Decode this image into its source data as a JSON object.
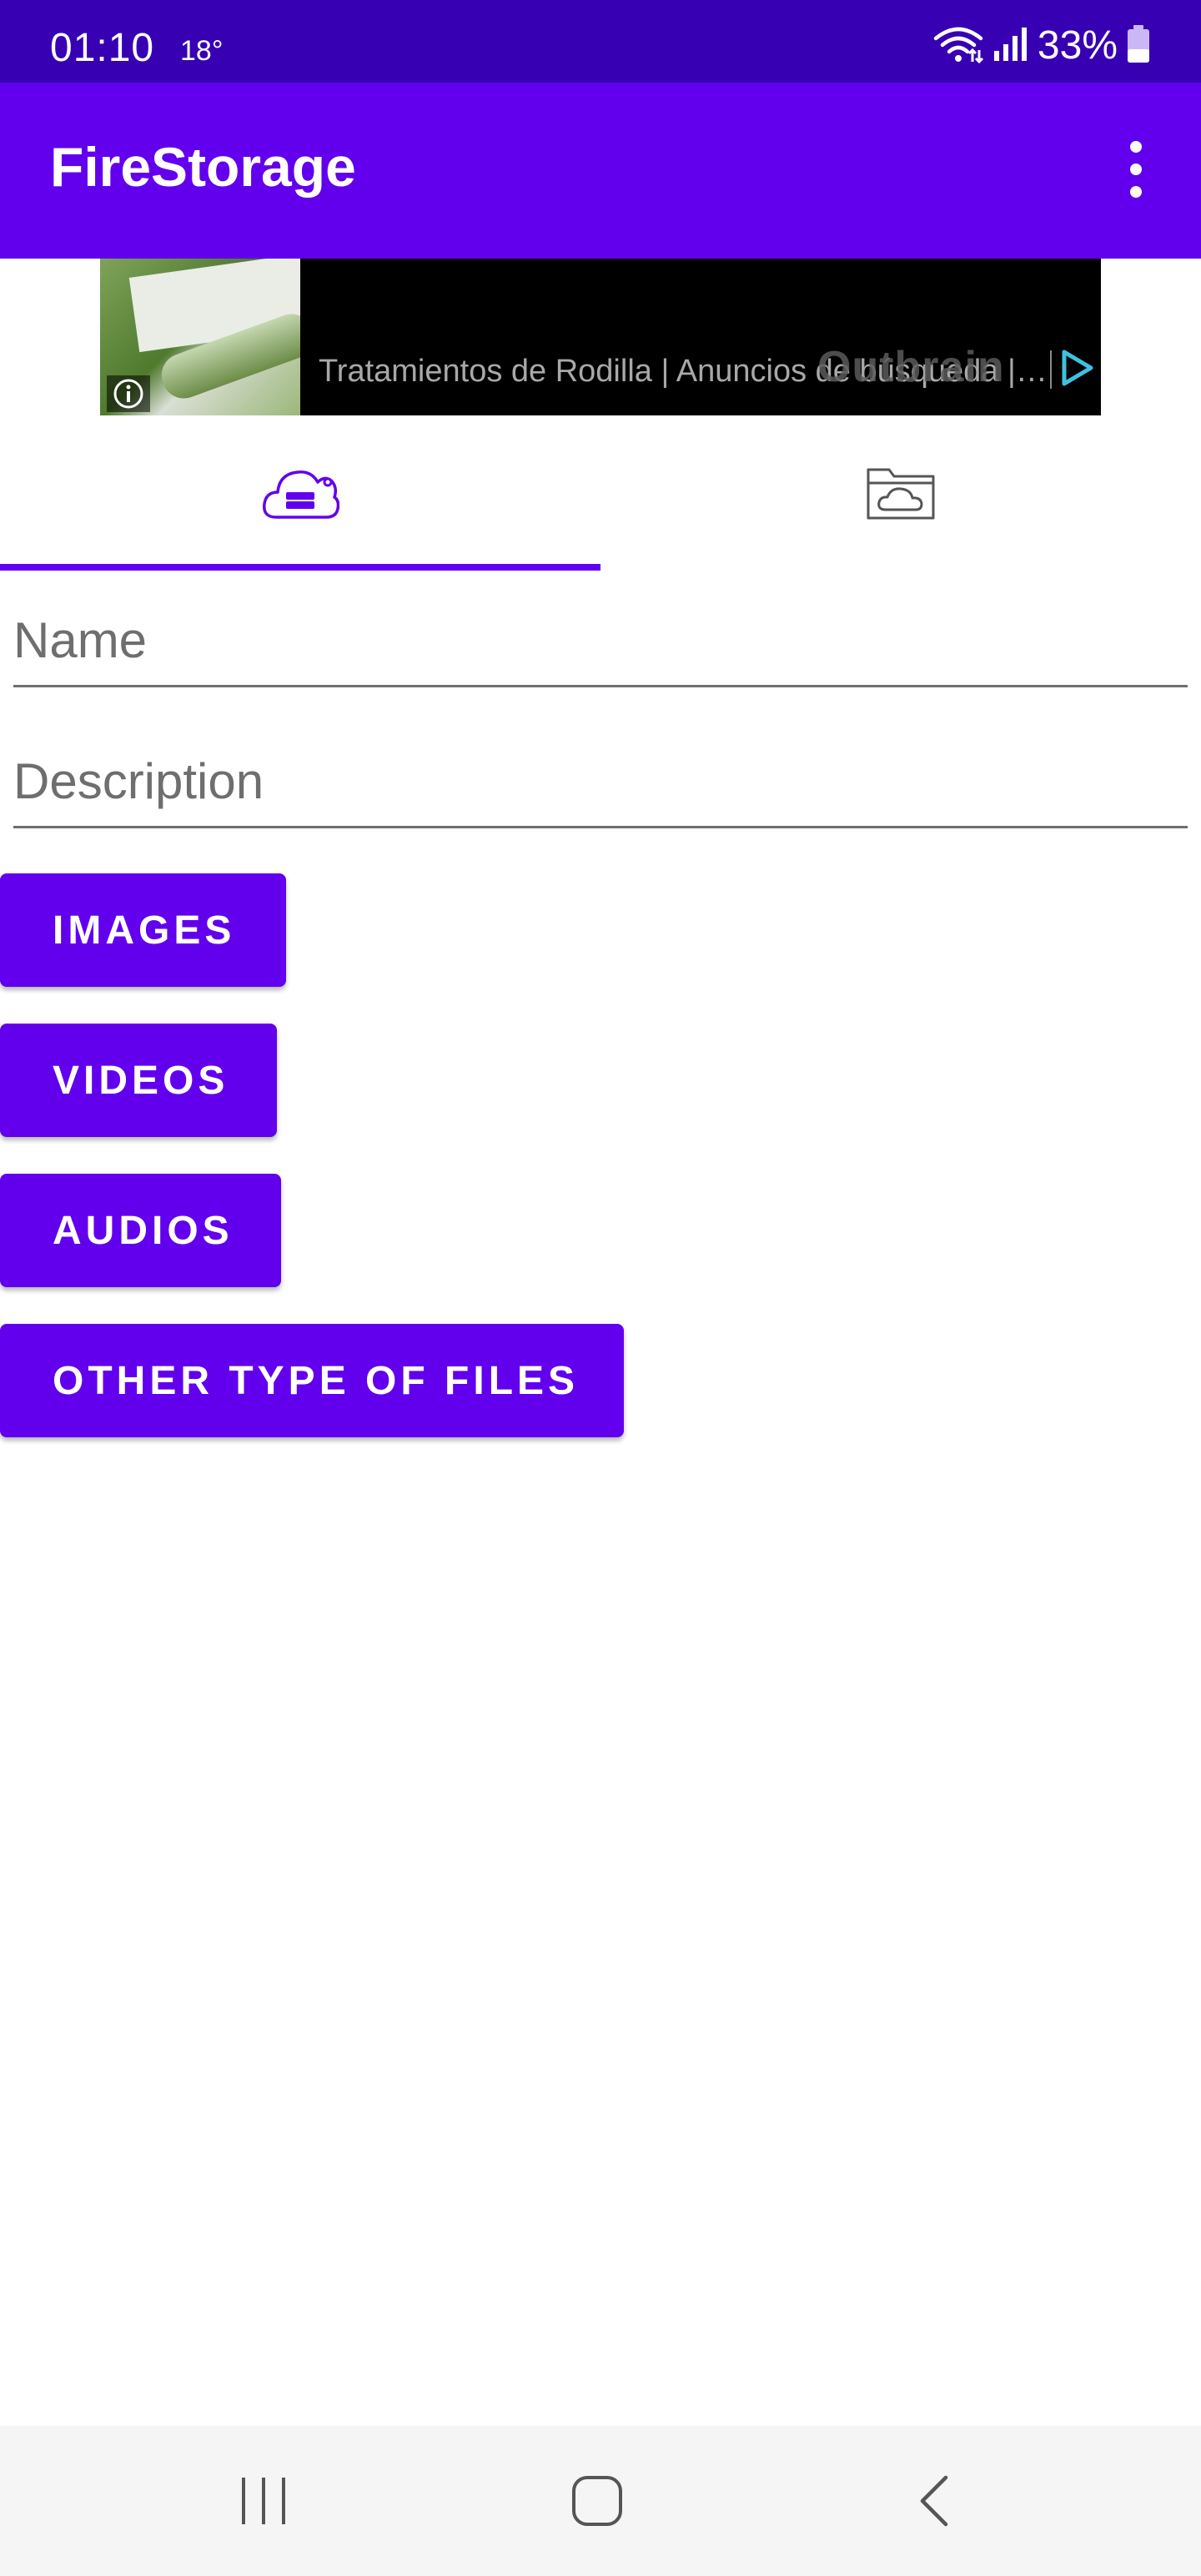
{
  "status_bar": {
    "time": "01:10",
    "temperature": "18°",
    "battery": "33%",
    "icons": [
      "wifi-icon",
      "signal-icon",
      "battery-icon"
    ]
  },
  "app_bar": {
    "title": "FireStorage",
    "menu_icon": "more-vert-icon"
  },
  "ad": {
    "text": "Tratamientos de Rodilla | Anuncios de búsqueda |…",
    "brand": "Outbrain",
    "icons": [
      "info-icon",
      "adchoices-icon"
    ]
  },
  "tabs": [
    {
      "icon": "cloud-storage-icon",
      "selected": true
    },
    {
      "icon": "cloud-folder-icon",
      "selected": false
    }
  ],
  "form": {
    "name_placeholder": "Name",
    "name_value": "",
    "description_placeholder": "Description",
    "description_value": ""
  },
  "buttons": {
    "images": "IMAGES",
    "videos": "VIDEOS",
    "audios": "AUDIOS",
    "other": "OTHER TYPE OF FILES"
  },
  "nav_bar": {
    "icons": [
      "recents-icon",
      "home-icon",
      "back-icon"
    ]
  },
  "colors": {
    "status_bar": "#3700B3",
    "primary": "#6200EE",
    "background": "#FFFFFF",
    "nav_bar": "#F5F5F5"
  }
}
